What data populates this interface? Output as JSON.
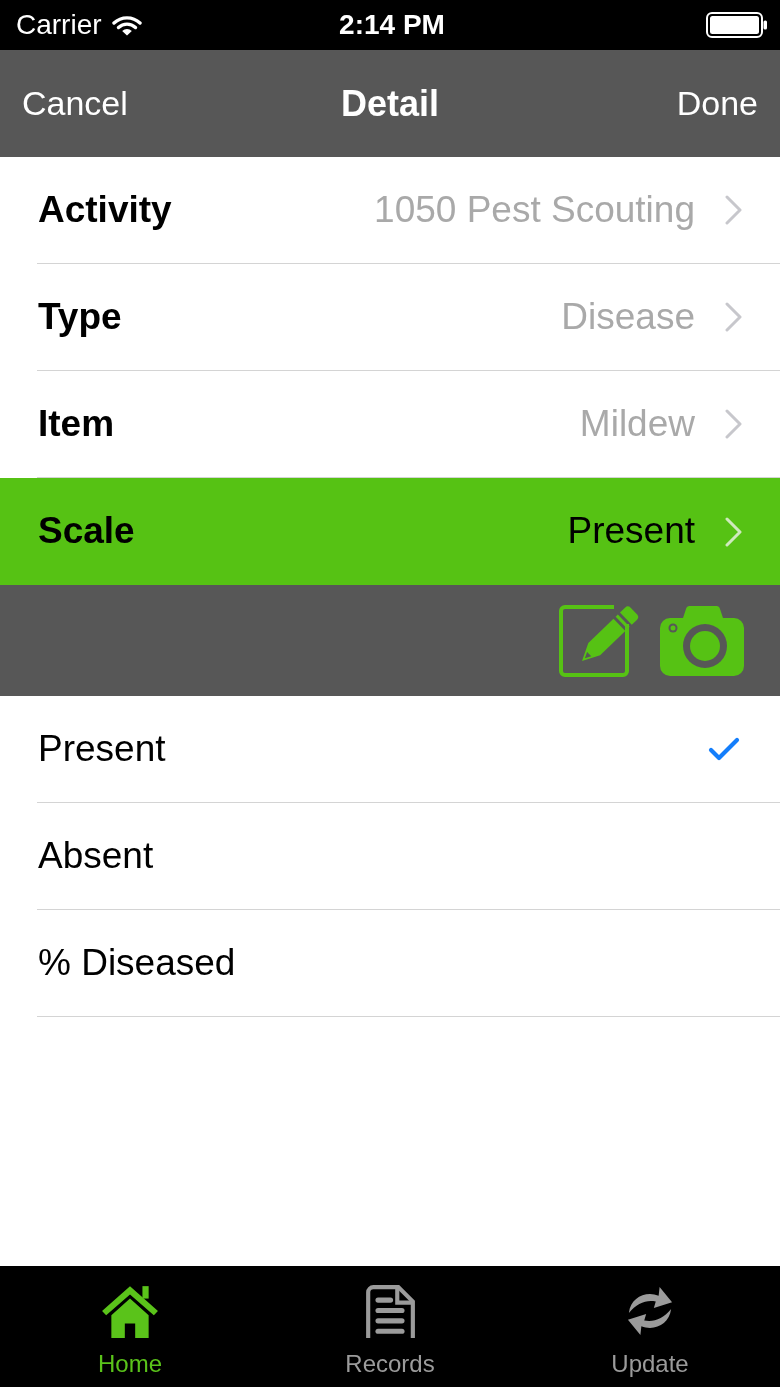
{
  "status_bar": {
    "carrier": "Carrier",
    "time": "2:14 PM"
  },
  "nav_bar": {
    "cancel": "Cancel",
    "title": "Detail",
    "done": "Done"
  },
  "fields": [
    {
      "label": "Activity",
      "value": "1050 Pest Scouting",
      "selected": false
    },
    {
      "label": "Type",
      "value": "Disease",
      "selected": false
    },
    {
      "label": "Item",
      "value": "Mildew",
      "selected": false
    },
    {
      "label": "Scale",
      "value": "Present",
      "selected": true
    }
  ],
  "options": [
    {
      "label": "Present",
      "selected": true
    },
    {
      "label": "Absent",
      "selected": false
    },
    {
      "label": "% Diseased",
      "selected": false
    }
  ],
  "tab_bar": [
    {
      "kind": "home",
      "label": "Home",
      "selected": true
    },
    {
      "kind": "records",
      "label": "Records",
      "selected": false
    },
    {
      "kind": "update",
      "label": "Update",
      "selected": false
    }
  ]
}
